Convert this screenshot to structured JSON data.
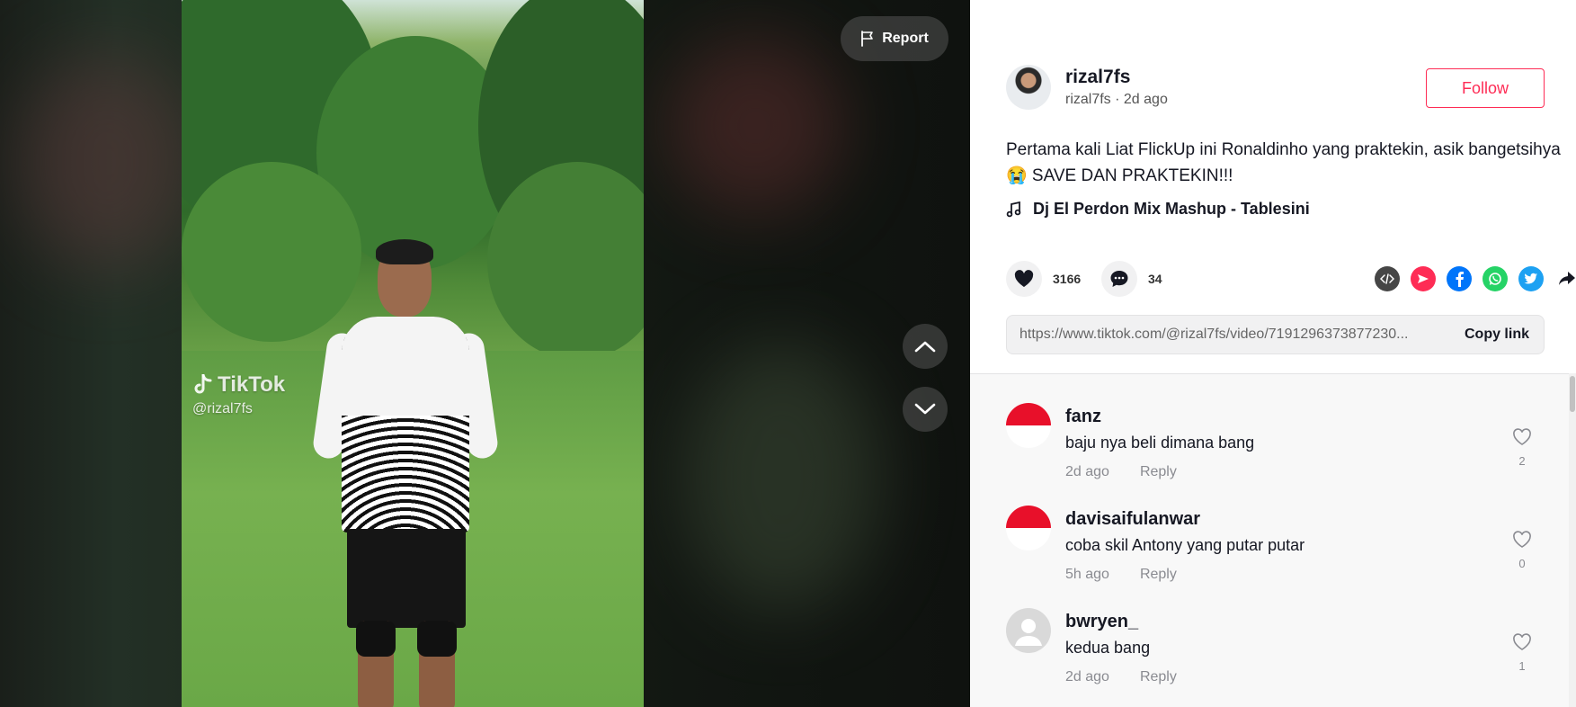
{
  "video": {
    "report_label": "Report",
    "watermark_logo": "TikTok",
    "watermark_handle": "@rizal7fs"
  },
  "post": {
    "author_username": "rizal7fs",
    "author_subline": "rizal7fs · 2d ago",
    "follow_label": "Follow",
    "caption": "Pertama kali Liat FlickUp ini Ronaldinho yang praktekin, asik bangetsihya😭 SAVE DAN PRAKTEKIN!!!",
    "music": "Dj El Perdon Mix Mashup - Tablesini",
    "likes": "3166",
    "comments_count": "34",
    "link": "https://www.tiktok.com/@rizal7fs/video/7191296373877230...",
    "copy_link_label": "Copy link"
  },
  "share_icons": [
    "embed-icon",
    "send-to-friends-icon",
    "facebook-icon",
    "whatsapp-icon",
    "twitter-icon",
    "share-arrow-icon"
  ],
  "colors": {
    "accent": "#fe2c55",
    "facebook": "#0075fa",
    "whatsapp": "#25d366",
    "twitter": "#1da1f2",
    "embed": "#464646"
  },
  "comments": [
    {
      "username": "fanz",
      "text": "baju nya beli dimana bang",
      "time": "2d ago",
      "reply_label": "Reply",
      "likes": "2",
      "avatar": "flag"
    },
    {
      "username": "davisaifulanwar",
      "text": "coba skil Antony yang putar putar",
      "time": "5h ago",
      "reply_label": "Reply",
      "likes": "0",
      "avatar": "flag"
    },
    {
      "username": "bwryen_",
      "text": "kedua bang",
      "time": "2d ago",
      "reply_label": "Reply",
      "likes": "1",
      "avatar": "default"
    }
  ]
}
